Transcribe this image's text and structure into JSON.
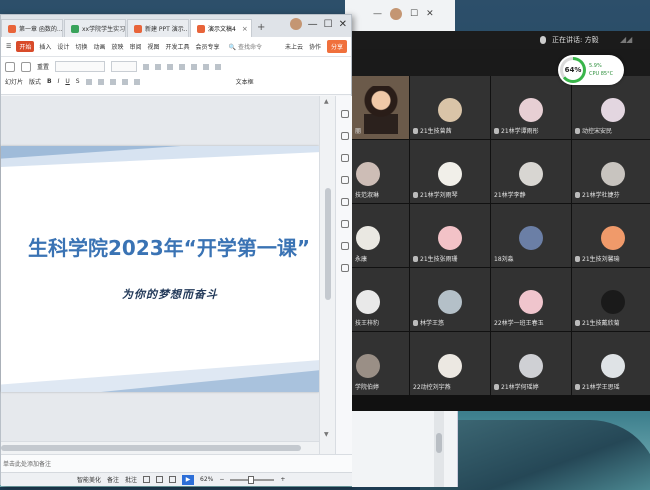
{
  "desktop": {},
  "bg_window": {
    "min": "—",
    "max": "☐",
    "close": "✕"
  },
  "wps": {
    "tabs": [
      {
        "label": "第一章 函数的...",
        "color": "#e8643a"
      },
      {
        "label": "xx学院学生实习...",
        "color": "#3aa35b"
      },
      {
        "label": "新建 PPT 演示...",
        "color": "#e8643a"
      },
      {
        "label": "演示文稿4",
        "color": "#e8643a"
      }
    ],
    "win_controls": {
      "min": "—",
      "max": "☐",
      "close": "✕"
    },
    "menu": {
      "items": [
        "开始",
        "插入",
        "设计",
        "切换",
        "动画",
        "放映",
        "审阅",
        "视图",
        "开发工具",
        "会员专享"
      ],
      "active_index": 0,
      "search": "查找命令",
      "cloud": "未上云",
      "collab": "协作",
      "share": "分享"
    },
    "ribbon": {
      "row1": [
        "重置"
      ],
      "row2_left": [
        "幻灯片",
        "版式"
      ],
      "row2_right": [
        "文本框"
      ]
    },
    "slide": {
      "title": "生科学院2023年“开学第一课”",
      "subtitle": "为你的梦想而奋斗"
    },
    "notes": {
      "placeholder": "单击此处添加备注"
    },
    "status": {
      "smart_beautify": "智能美化",
      "notes": "备注",
      "comments": "批注",
      "zoom": "62%"
    }
  },
  "meeting": {
    "speaking_label": "正在讲话: 方毅",
    "cpu": {
      "percent": "64%",
      "info1": "5.9%",
      "info2": "CPU 85°C"
    },
    "participants": [
      {
        "name": "丽",
        "type": "video",
        "muted": false
      },
      {
        "name": "21生技曾茜",
        "color": "#d9c4a8",
        "muted": true
      },
      {
        "name": "21林学谭雨彤",
        "color": "#e7cfd4",
        "muted": true
      },
      {
        "name": "动控宋安民",
        "color": "#e3d6e0",
        "muted": true
      },
      {
        "name": "技范淑琳",
        "color": "#cdbdb6",
        "muted": false
      },
      {
        "name": "21林学刘雨琴",
        "color": "#f1efe9",
        "muted": true
      },
      {
        "name": "21林学李静",
        "color": "#d8d6d2",
        "muted": false
      },
      {
        "name": "21林学杜婕芬",
        "color": "#c8c4bf",
        "muted": true
      },
      {
        "name": "永康",
        "color": "#eae8e2",
        "muted": false
      },
      {
        "name": "21生技张雨珊",
        "color": "#f2c2c7",
        "muted": true
      },
      {
        "name": "18刘淼",
        "color": "#6b7fa6",
        "muted": false
      },
      {
        "name": "21生技刘馨瑜",
        "color": "#f09a6a",
        "muted": true
      },
      {
        "name": "技王梓豹",
        "color": "#e9e9e9",
        "muted": false
      },
      {
        "name": "林学王悠",
        "color": "#b4c0c8",
        "muted": true
      },
      {
        "name": "22林学一班王春玉",
        "color": "#f0c5cd",
        "muted": false
      },
      {
        "name": "21生技戴欣菊",
        "color": "#1a1a1a",
        "muted": true
      },
      {
        "name": "学院伯婷",
        "color": "#9a8f86",
        "muted": false
      },
      {
        "name": "22动控刘宇燕",
        "color": "#ece8e2",
        "muted": false
      },
      {
        "name": "21林学何瑶婷",
        "color": "#cfd0d4",
        "muted": true
      },
      {
        "name": "21林学王思瑶",
        "color": "#dfe3e6",
        "muted": true
      }
    ]
  }
}
